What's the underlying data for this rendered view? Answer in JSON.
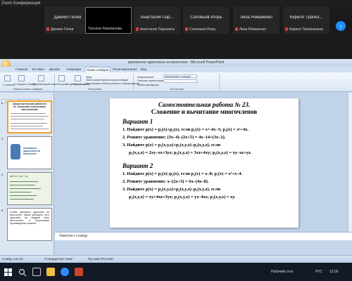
{
  "zoom": {
    "title": "Zoom Конференция",
    "tiles": [
      {
        "name": "Даниил Гилев",
        "sub": "Даниил Гилев"
      },
      {
        "name": "",
        "sub": "Татьяна Черепанова"
      },
      {
        "name": "Анастасия Пар...",
        "sub": "Анастасия Паранина"
      },
      {
        "name": "Соловьев Игорь",
        "sub": "Соловьев Игорь"
      },
      {
        "name": "Лиза Романенко",
        "sub": "Лиза Романенко"
      },
      {
        "name": "Кирилл Трапез...",
        "sub": "Кирилл Трапезников"
      }
    ],
    "next_arrow": "›"
  },
  "ppt": {
    "window_title": "умножение одночлена на многочлен - Microsoft PowerPoint",
    "tabs": [
      "Главная",
      "Вставка",
      "Дизайн",
      "Анимация",
      "Показ слайдов",
      "Рецензирование",
      "Вид"
    ],
    "ribbon": {
      "groups": [
        "Начать показ слайдов",
        "Настройка",
        "Мониторы"
      ],
      "items": [
        "С начала",
        "С текущего слайда",
        "Произвольный показ",
        "Настройка демонстрации",
        "Скрыть слайд",
        "Звук",
        "Использовать время показа слайдов",
        "Использовать запись речевого сопровождения",
        "Разрешение:",
        "Использовать текущее",
        "Показать презентацию на:",
        "Режим докладчика"
      ]
    },
    "panel_tabs": [
      "Слайды",
      "Структура"
    ],
    "thumbnails": [
      {
        "num": "2",
        "text": "Самостоятельная работа № 23. Сложение и вычитание многочленов"
      },
      {
        "num": "3",
        "text": "Умножение одночлена на многочлен"
      },
      {
        "num": "4",
        "text": "a(b+c) = ab + ac"
      },
      {
        "num": "5",
        "text": "Чтобы умножить одночлен на многочлен, нужно умножить этот одночлен на каждый член многочлена и полученные произведения сложить."
      }
    ],
    "slide": {
      "title1": "Самостоятельная работа № 23.",
      "title2": "Сложение и вычитание многочленов",
      "variant1": "Вариант 1",
      "v1_lines": [
        "1. Найдите p(x) = p₁(x)+p₂(x), если p₁(x) = x³–4x–3; p₂(x) = x³+4x.",
        "2. Решите уравнение: (3x–4)–(2x+5) = 4x–14+(3x–2).",
        "3. Найдите p(x) = p₁(x,y,z)+p₂(x,y,z)–p₃(x,y,z), если",
        "p₁(x,y,z) = 2xy–xz+3yz; p₂(x,y,z) = 3xz+4xy; p₃(x,y,z) = xy–xz+yz."
      ],
      "variant2": "Вариант 2",
      "v2_lines": [
        "1. Найдите p(x) = p₁(x)–p₂(x), если p₁(x) = x–8; p₂(x) = x³+x–4.",
        "2. Решите уравнение: x–(2x+3) = 6x–(4x–8).",
        "3. Найдите p(x) = p₁(x,y,z)+p₂(x,y,z)–p₃(x,y,z), если",
        "p₁(x,y,z) = xy+4xz+3yz; p₂(x,y,z) = yz–4xz; p₃(x,y,z) = xy."
      ]
    },
    "notes_placeholder": "Заметки к слайду",
    "status": {
      "slide": "Слайд 1 из 33",
      "theme": "\"Стандартная тема\"",
      "lang": "Русский (Россия)"
    }
  },
  "taskbar": {
    "desktop": "Рабочий стол",
    "lang": "РУС",
    "time": "13:30"
  }
}
